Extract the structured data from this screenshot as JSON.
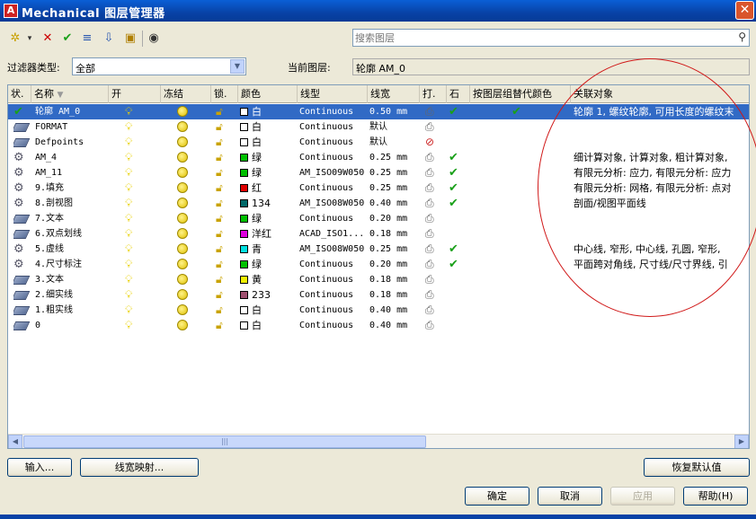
{
  "window": {
    "title": "Mechanical 图层管理器",
    "app_icon": "autocad-icon",
    "close_label": "✕"
  },
  "toolbar": {
    "buttons": [
      {
        "name": "new-layer-icon",
        "glyph": "✲"
      },
      {
        "name": "dropdown-arrow-icon",
        "glyph": "▾"
      },
      {
        "name": "delete-layer-icon",
        "glyph": "✕"
      },
      {
        "name": "set-current-icon",
        "glyph": "✔"
      },
      {
        "name": "layer-states-icon",
        "glyph": "≡"
      },
      {
        "name": "layer-tools-icon",
        "glyph": "⇩"
      },
      {
        "name": "layer-lock-icon",
        "glyph": "▣"
      },
      {
        "name": "eye-icon",
        "glyph": "◉"
      }
    ]
  },
  "search": {
    "placeholder": "搜索图层",
    "icon": "magnifier-icon"
  },
  "filter": {
    "label": "过滤器类型:",
    "value": "全部"
  },
  "current_layer": {
    "label": "当前图层:",
    "value": "轮廓 AM_0"
  },
  "columns": {
    "status": "状.",
    "name": "名称",
    "on": "开",
    "freeze": "冻结",
    "lock": "锁.",
    "color": "颜色",
    "linetype": "线型",
    "lineweight": "线宽",
    "plot": "打.",
    "plot_check": "石",
    "override": "按图层组替代颜色",
    "assoc": "关联对象"
  },
  "rows": [
    {
      "status": "check",
      "name": "轮廓 AM_0",
      "color": "白",
      "swatch": "#ffffff",
      "linetype": "Continuous",
      "lineweight": "0.50 mm",
      "plot": true,
      "plot_check": true,
      "override_check": true,
      "assoc": "轮廓 1, 螺纹轮廓, 可用长度的螺纹末",
      "selected": true
    },
    {
      "status": "layer",
      "name": "FORMAT",
      "color": "白",
      "swatch": "#ffffff",
      "linetype": "Continuous",
      "lineweight": "默认",
      "plot": true,
      "plot_check": false,
      "override_check": false,
      "assoc": "",
      "selected": false
    },
    {
      "status": "layer",
      "name": "Defpoints",
      "color": "白",
      "swatch": "#ffffff",
      "linetype": "Continuous",
      "lineweight": "默认",
      "plot": false,
      "plot_check": false,
      "override_check": false,
      "assoc": "",
      "selected": false
    },
    {
      "status": "gear",
      "name": "AM_4",
      "color": "绿",
      "swatch": "#00c000",
      "linetype": "Continuous",
      "lineweight": "0.25 mm",
      "plot": true,
      "plot_check": true,
      "override_check": false,
      "assoc": "细计算对象, 计算对象, 粗计算对象,",
      "selected": false
    },
    {
      "status": "gear",
      "name": "AM_11",
      "color": "绿",
      "swatch": "#00c000",
      "linetype": "AM_ISO09W050",
      "lineweight": "0.25 mm",
      "plot": true,
      "plot_check": true,
      "override_check": false,
      "assoc": "有限元分析: 应力, 有限元分析: 应力",
      "selected": false
    },
    {
      "status": "gear",
      "name": "9.填充",
      "color": "红",
      "swatch": "#e00000",
      "linetype": "Continuous",
      "lineweight": "0.25 mm",
      "plot": true,
      "plot_check": true,
      "override_check": false,
      "assoc": "有限元分析: 网格, 有限元分析: 点对",
      "selected": false
    },
    {
      "status": "gear",
      "name": "8.剖视图",
      "color": "134",
      "swatch": "#006868",
      "linetype": "AM_ISO08W050",
      "lineweight": "0.40 mm",
      "plot": true,
      "plot_check": true,
      "override_check": false,
      "assoc": "剖面/视图平面线",
      "selected": false
    },
    {
      "status": "layer",
      "name": "7.文本",
      "color": "绿",
      "swatch": "#00c000",
      "linetype": "Continuous",
      "lineweight": "0.20 mm",
      "plot": true,
      "plot_check": false,
      "override_check": false,
      "assoc": "",
      "selected": false
    },
    {
      "status": "layer",
      "name": "6.双点划线",
      "color": "洋红",
      "swatch": "#e000e0",
      "linetype": "ACAD_ISO1...",
      "lineweight": "0.18 mm",
      "plot": true,
      "plot_check": false,
      "override_check": false,
      "assoc": "",
      "selected": false
    },
    {
      "status": "gear",
      "name": "5.虚线",
      "color": "青",
      "swatch": "#00e0e0",
      "linetype": "AM_ISO08W050",
      "lineweight": "0.25 mm",
      "plot": true,
      "plot_check": true,
      "override_check": false,
      "assoc": "中心线, 窄形, 中心线, 孔圆, 窄形,",
      "selected": false
    },
    {
      "status": "gear",
      "name": "4.尺寸标注",
      "color": "绿",
      "swatch": "#00c000",
      "linetype": "Continuous",
      "lineweight": "0.20 mm",
      "plot": true,
      "plot_check": true,
      "override_check": false,
      "assoc": "平面跨对角线, 尺寸线/尺寸界线, 引",
      "selected": false
    },
    {
      "status": "layer",
      "name": "3.文本",
      "color": "黄",
      "swatch": "#f0f000",
      "linetype": "Continuous",
      "lineweight": "0.18 mm",
      "plot": true,
      "plot_check": false,
      "override_check": false,
      "assoc": "",
      "selected": false
    },
    {
      "status": "layer",
      "name": "2.细实线",
      "color": "233",
      "swatch": "#a05070",
      "linetype": "Continuous",
      "lineweight": "0.18 mm",
      "plot": true,
      "plot_check": false,
      "override_check": false,
      "assoc": "",
      "selected": false
    },
    {
      "status": "layer",
      "name": "1.粗实线",
      "color": "白",
      "swatch": "#ffffff",
      "linetype": "Continuous",
      "lineweight": "0.40 mm",
      "plot": true,
      "plot_check": false,
      "override_check": false,
      "assoc": "",
      "selected": false
    },
    {
      "status": "layer",
      "name": "0",
      "color": "白",
      "swatch": "#ffffff",
      "linetype": "Continuous",
      "lineweight": "0.40 mm",
      "plot": true,
      "plot_check": false,
      "override_check": false,
      "assoc": "",
      "selected": false
    }
  ],
  "buttons": {
    "import": "输入...",
    "lineweight_map": "线宽映射...",
    "restore_defaults": "恢复默认值",
    "ok": "确定",
    "cancel": "取消",
    "apply": "应用",
    "help": "帮助(H)"
  },
  "colors": {
    "selection": "#316ac5",
    "annotation_ellipse": "#d01818"
  }
}
